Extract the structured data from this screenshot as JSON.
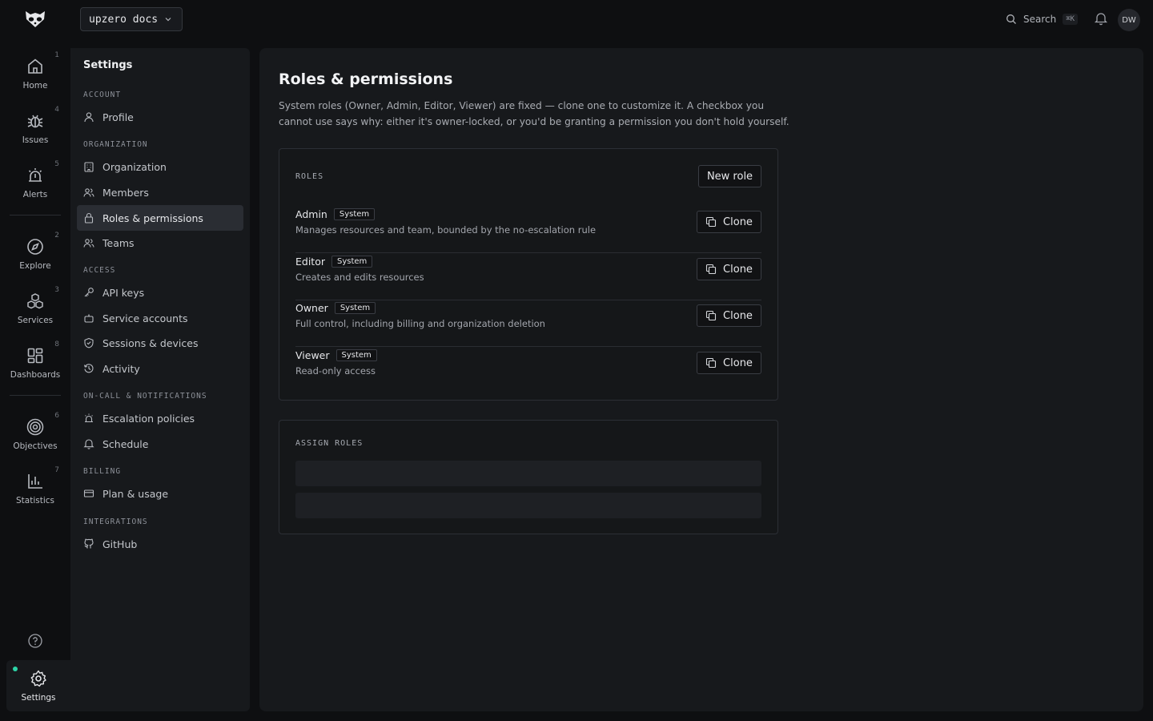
{
  "topbar": {
    "workspace": "upzero docs",
    "search_label": "Search",
    "search_shortcut": "⌘K",
    "avatar_initials": "DW"
  },
  "rail": {
    "items": [
      {
        "label": "Home",
        "num": "1",
        "icon": "home-icon"
      },
      {
        "label": "Issues",
        "num": "4",
        "icon": "bug-icon"
      },
      {
        "label": "Alerts",
        "num": "5",
        "icon": "siren-icon"
      },
      {
        "label": "Explore",
        "num": "2",
        "icon": "compass-icon"
      },
      {
        "label": "Services",
        "num": "3",
        "icon": "boxes-icon"
      },
      {
        "label": "Dashboards",
        "num": "8",
        "icon": "grid-icon"
      },
      {
        "label": "Objectives",
        "num": "6",
        "icon": "target-icon"
      },
      {
        "label": "Statistics",
        "num": "7",
        "icon": "chart-icon"
      }
    ],
    "settings_label": "Settings",
    "accent": "#2dd4a7"
  },
  "settings_nav": {
    "title": "Settings",
    "sections": [
      {
        "label": "ACCOUNT",
        "items": [
          "Profile"
        ]
      },
      {
        "label": "ORGANIZATION",
        "items": [
          "Organization",
          "Members",
          "Roles & permissions",
          "Teams"
        ]
      },
      {
        "label": "ACCESS",
        "items": [
          "API keys",
          "Service accounts",
          "Sessions & devices",
          "Activity"
        ]
      },
      {
        "label": "ON-CALL & NOTIFICATIONS",
        "items": [
          "Escalation policies",
          "Schedule"
        ]
      },
      {
        "label": "BILLING",
        "items": [
          "Plan & usage"
        ]
      },
      {
        "label": "INTEGRATIONS",
        "items": [
          "GitHub"
        ]
      }
    ],
    "active": "Roles & permissions"
  },
  "main": {
    "title": "Roles & permissions",
    "description": "System roles (Owner, Admin, Editor, Viewer) are fixed — clone one to customize it. A checkbox you cannot use says why: either it's owner-locked, or you'd be granting a permission you don't hold yourself.",
    "roles_label": "ROLES",
    "new_role_label": "New role",
    "clone_label": "Clone",
    "system_badge": "System",
    "roles": [
      {
        "name": "Admin",
        "desc": "Manages resources and team, bounded by the no-escalation rule"
      },
      {
        "name": "Editor",
        "desc": "Creates and edits resources"
      },
      {
        "name": "Owner",
        "desc": "Full control, including billing and organization deletion"
      },
      {
        "name": "Viewer",
        "desc": "Read-only access"
      }
    ],
    "assign_label": "ASSIGN ROLES"
  }
}
